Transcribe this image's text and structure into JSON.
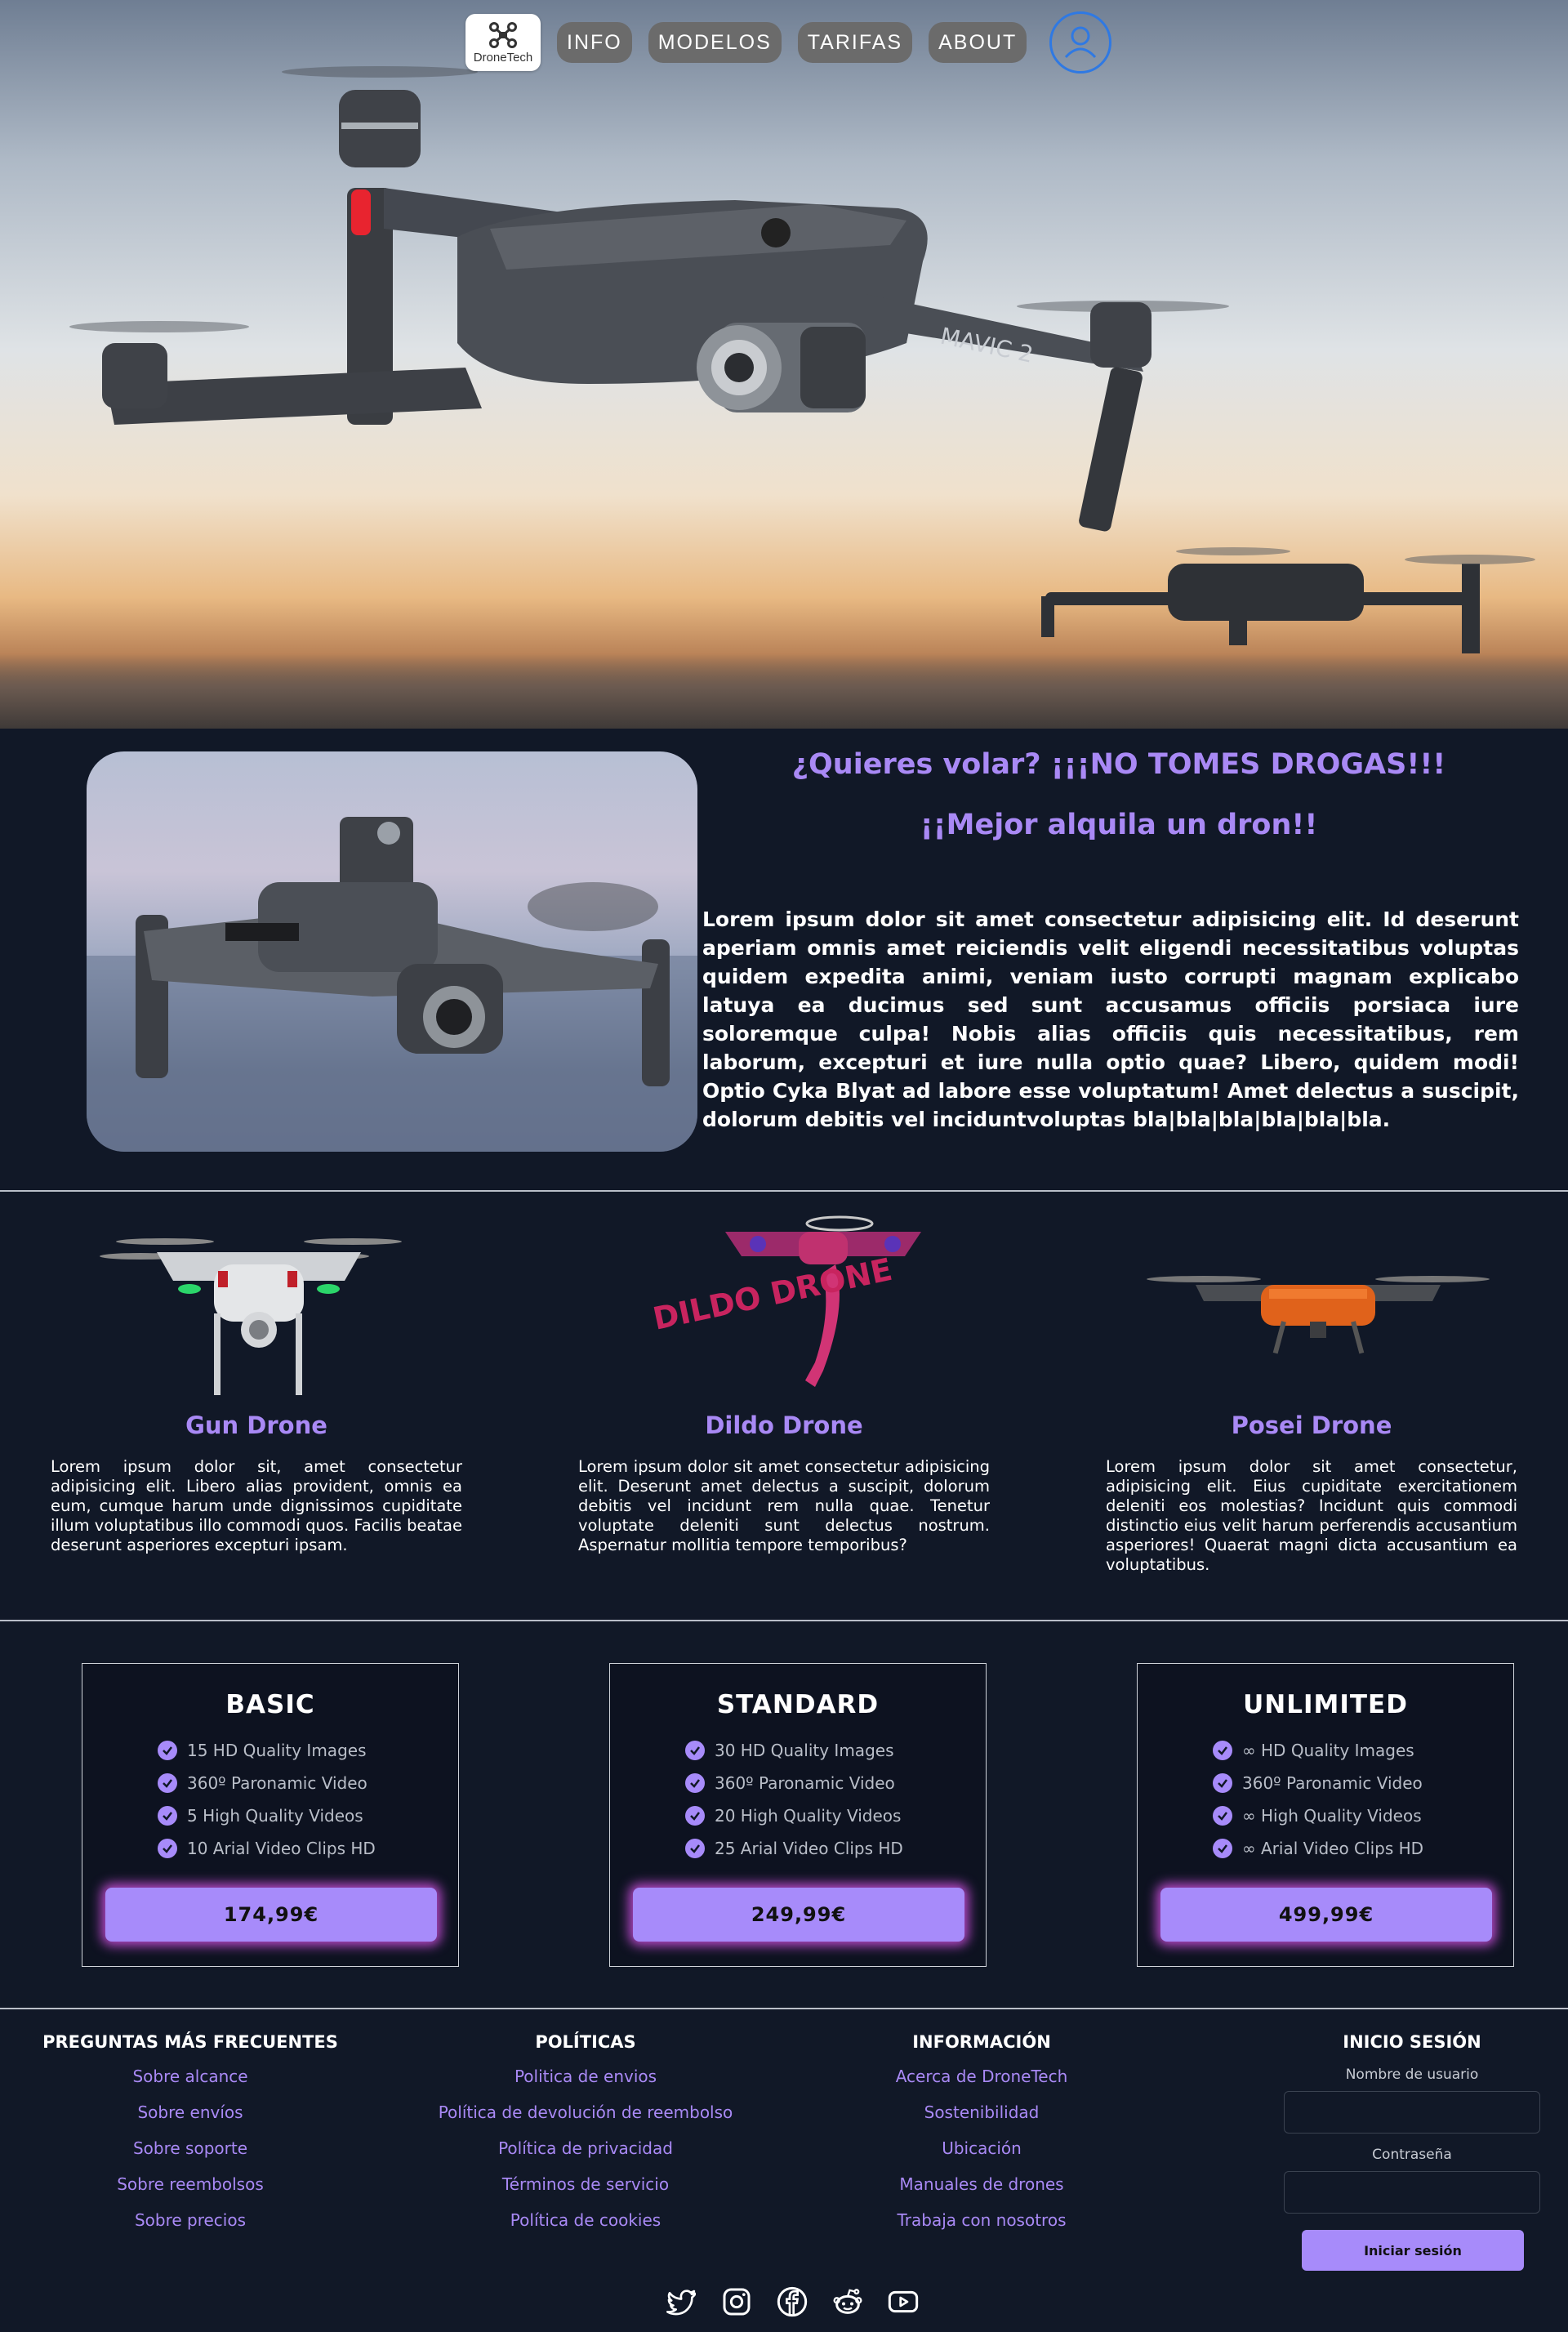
{
  "nav": {
    "logo_text": "DroneTech",
    "items": [
      "INFO",
      "MODELOS",
      "TARIFAS",
      "ABOUT"
    ],
    "profile_icon": "user-circle-icon"
  },
  "hero": {
    "image": "drone-flying-sunset-photo",
    "drone_label": "MAVIC 2"
  },
  "intro": {
    "title1": "¿Quieres volar? ¡¡¡NO TOMES DROGAS!!!",
    "title2": "¡¡Mejor alquila un dron!!",
    "text": "Lorem ipsum dolor sit amet consectetur adipisicing elit. Id deserunt aperiam omnis amet reiciendis velit eligendi necessitatibus voluptas quidem expedita animi, veniam iusto corrupti magnam explicabo latuya ea ducimus sed sunt accusamus officiis porsiaca iure soloremque culpa! Nobis alias officiis quis necessitatibus, rem laborum, excepturi et iure nulla optio quae? Libero, quidem modi! Optio Cyka Blyat ad labore esse voluptatum! Amet delectus a suscipit, dolorum debitis vel inciduntvoluptas bla|bla|bla|bla|bla|bla."
  },
  "products": [
    {
      "name": "Gun Drone",
      "text": "Lorem ipsum dolor sit, amet consectetur adipisicing elit. Libero alias provident, omnis ea eum, cumque harum unde dignissimos cupiditate illum voluptatibus illo commodi quos. Facilis beatae deserunt asperiores excepturi ipsam."
    },
    {
      "name": "Dildo Drone",
      "text": "Lorem ipsum dolor sit amet consectetur adipisicing elit. Deserunt amet delectus a suscipit, dolorum debitis vel incidunt rem nulla quae. Tenetur voluptate deleniti sunt delectus nostrum. Aspernatur mollitia tempore temporibus?",
      "image_caption": "DILDO DRONE"
    },
    {
      "name": "Posei Drone",
      "text": "Lorem ipsum dolor sit amet consectetur, adipisicing elit. Eius cupiditate exercitationem deleniti eos molestias? Incidunt quis commodi distinctio eius velit harum perferendis accusantium asperiores! Quaerat magni dicta accusantium ea voluptatibus."
    }
  ],
  "plans": [
    {
      "name": "BASIC",
      "features": [
        "15 HD Quality Images",
        "360º Paronamic Video",
        "5 High Quality Videos",
        "10 Arial Video Clips HD"
      ],
      "price": "174,99€"
    },
    {
      "name": "STANDARD",
      "features": [
        "30 HD Quality Images",
        "360º Paronamic Video",
        "20 High Quality Videos",
        "25 Arial Video Clips HD"
      ],
      "price": "249,99€"
    },
    {
      "name": "UNLIMITED",
      "features": [
        "∞ HD Quality Images",
        "360º Paronamic Video",
        "∞ High Quality Videos",
        "∞ Arial Video Clips HD"
      ],
      "price": "499,99€"
    }
  ],
  "footer": {
    "faq": {
      "title": "PREGUNTAS MÁS FRECUENTES",
      "links": [
        "Sobre alcance",
        "Sobre envíos",
        "Sobre soporte",
        "Sobre reembolsos",
        "Sobre precios"
      ]
    },
    "policies": {
      "title": "POLÍTICAS",
      "links": [
        "Politica de envios",
        "Política de devolución de reembolso",
        "Política de privacidad",
        "Términos de servicio",
        "Política de cookies"
      ]
    },
    "info": {
      "title": "INFORMACIÓN",
      "links": [
        "Acerca de DroneTech",
        "Sostenibilidad",
        "Ubicación",
        "Manuales de drones",
        "Trabaja con nosotros"
      ]
    },
    "login": {
      "title": "INICIO SESIÓN",
      "user_label": "Nombre de usuario",
      "user_value": "",
      "pass_label": "Contraseña",
      "pass_value": "",
      "button": "Iniciar sesión"
    },
    "social_icons": [
      "twitter-icon",
      "instagram-icon",
      "facebook-icon",
      "reddit-icon",
      "youtube-icon"
    ]
  },
  "colors": {
    "accent": "#a78bfa",
    "background": "#111827",
    "nav_button": "#6b6b6b",
    "profile_ring": "#2f79e3",
    "price_glow": "#d652e8"
  }
}
